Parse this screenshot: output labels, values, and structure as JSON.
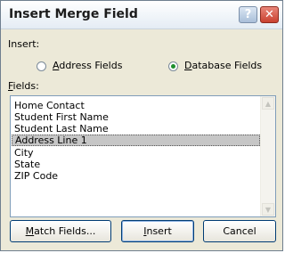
{
  "window": {
    "title": "Insert Merge Field",
    "help_glyph": "?",
    "close_glyph": "✕"
  },
  "insert": {
    "label": "Insert:",
    "options": [
      {
        "label_prefix": "",
        "mnemonic": "A",
        "label_rest": "ddress Fields",
        "selected": false
      },
      {
        "label_prefix": "",
        "mnemonic": "D",
        "label_rest": "atabase Fields",
        "selected": true
      }
    ]
  },
  "fields": {
    "label_mnemonic": "F",
    "label_rest": "ields:",
    "items": [
      "Home Contact",
      "Student First Name",
      "Student Last Name",
      "Address Line 1",
      "City",
      "State",
      "ZIP Code"
    ],
    "selected_index": 3
  },
  "buttons": {
    "match": {
      "mnemonic": "M",
      "rest": "atch Fields..."
    },
    "insert": {
      "mnemonic": "I",
      "rest": "nsert"
    },
    "cancel": "Cancel"
  },
  "colors": {
    "dialog_bg": "#ece9d8",
    "selection_bg": "#c6c6c6",
    "radio_dot": "#1e8f2e"
  }
}
